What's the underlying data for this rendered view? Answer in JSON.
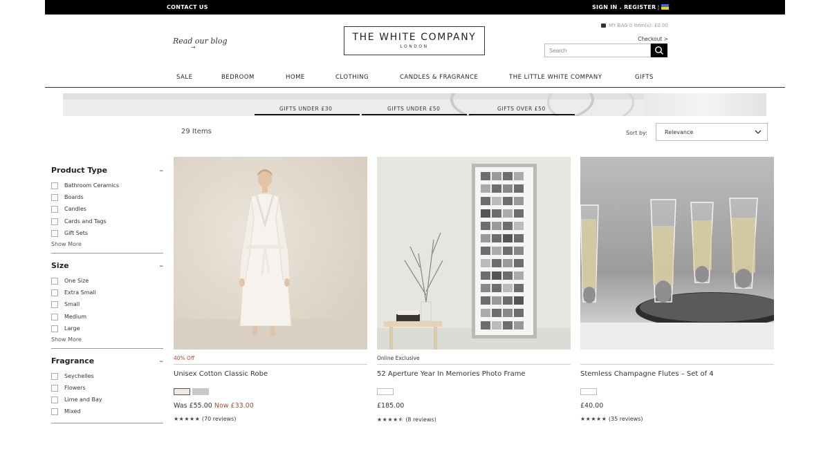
{
  "topbar": {
    "contact": "CONTACT US",
    "signin": "SIGN IN . REGISTER",
    "separator": "¦"
  },
  "header": {
    "blog": "Read our blog",
    "blog_arrow": "→",
    "logo_main": "THE WHITE COMPANY",
    "logo_sub": "LONDON",
    "bag_text": "MY BAG 0 item(s): £0.00",
    "checkout": "Checkout >",
    "search_placeholder": "Search"
  },
  "nav": [
    "SALE",
    "BEDROOM",
    "HOME",
    "CLOTHING",
    "CANDLES & FRAGRANCE",
    "THE LITTLE WHITE COMPANY",
    "GIFTS"
  ],
  "banner": [
    "GIFTS UNDER £30",
    "GIFTS UNDER £50",
    "GIFTS OVER £50"
  ],
  "toolbar": {
    "count": "29 Items",
    "sort_label": "Sort by:",
    "sort_value": "Relevance"
  },
  "filters": [
    {
      "title": "Product Type",
      "collapse": "–",
      "options": [
        "Bathroom Ceramics",
        "Boards",
        "Candles",
        "Cards and Tags",
        "Gift Sets"
      ],
      "show_more": "Show More"
    },
    {
      "title": "Size",
      "collapse": "–",
      "options": [
        "One Size",
        "Extra Small",
        "Small",
        "Medium",
        "Large"
      ],
      "show_more": "Show More"
    },
    {
      "title": "Fragrance",
      "collapse": "–",
      "options": [
        "Seychelles",
        "Flowers",
        "Lime and Bay",
        "Mixed"
      ],
      "show_more": ""
    }
  ],
  "products": [
    {
      "tag": "40% Off",
      "tag_color": "#c2462a",
      "name": "Unisex Cotton Classic Robe",
      "swatches": [
        "#efebe4",
        "#c8c8c8"
      ],
      "was": "Was £55.00 ",
      "price": "Now £33.00",
      "stars": "★★★★★",
      "reviews": "(70 reviews)"
    },
    {
      "tag": "Online Exclusive",
      "tag_color": "#333333",
      "name": "52 Aperture Year In Memories Photo Frame",
      "swatches": [
        "#ffffff"
      ],
      "was": "",
      "price": "£185.00",
      "stars": "★★★★⯪",
      "reviews": "(8 reviews)"
    },
    {
      "tag": "",
      "tag_color": "#333333",
      "name": "Stemless Champagne Flutes – Set of 4",
      "swatches": [
        "#ffffff"
      ],
      "was": "",
      "price": "£40.00",
      "stars": "★★★★★",
      "reviews": "(35 reviews)"
    }
  ],
  "colors": {
    "sale_red": "#c2462a",
    "topbar": "#000000"
  }
}
